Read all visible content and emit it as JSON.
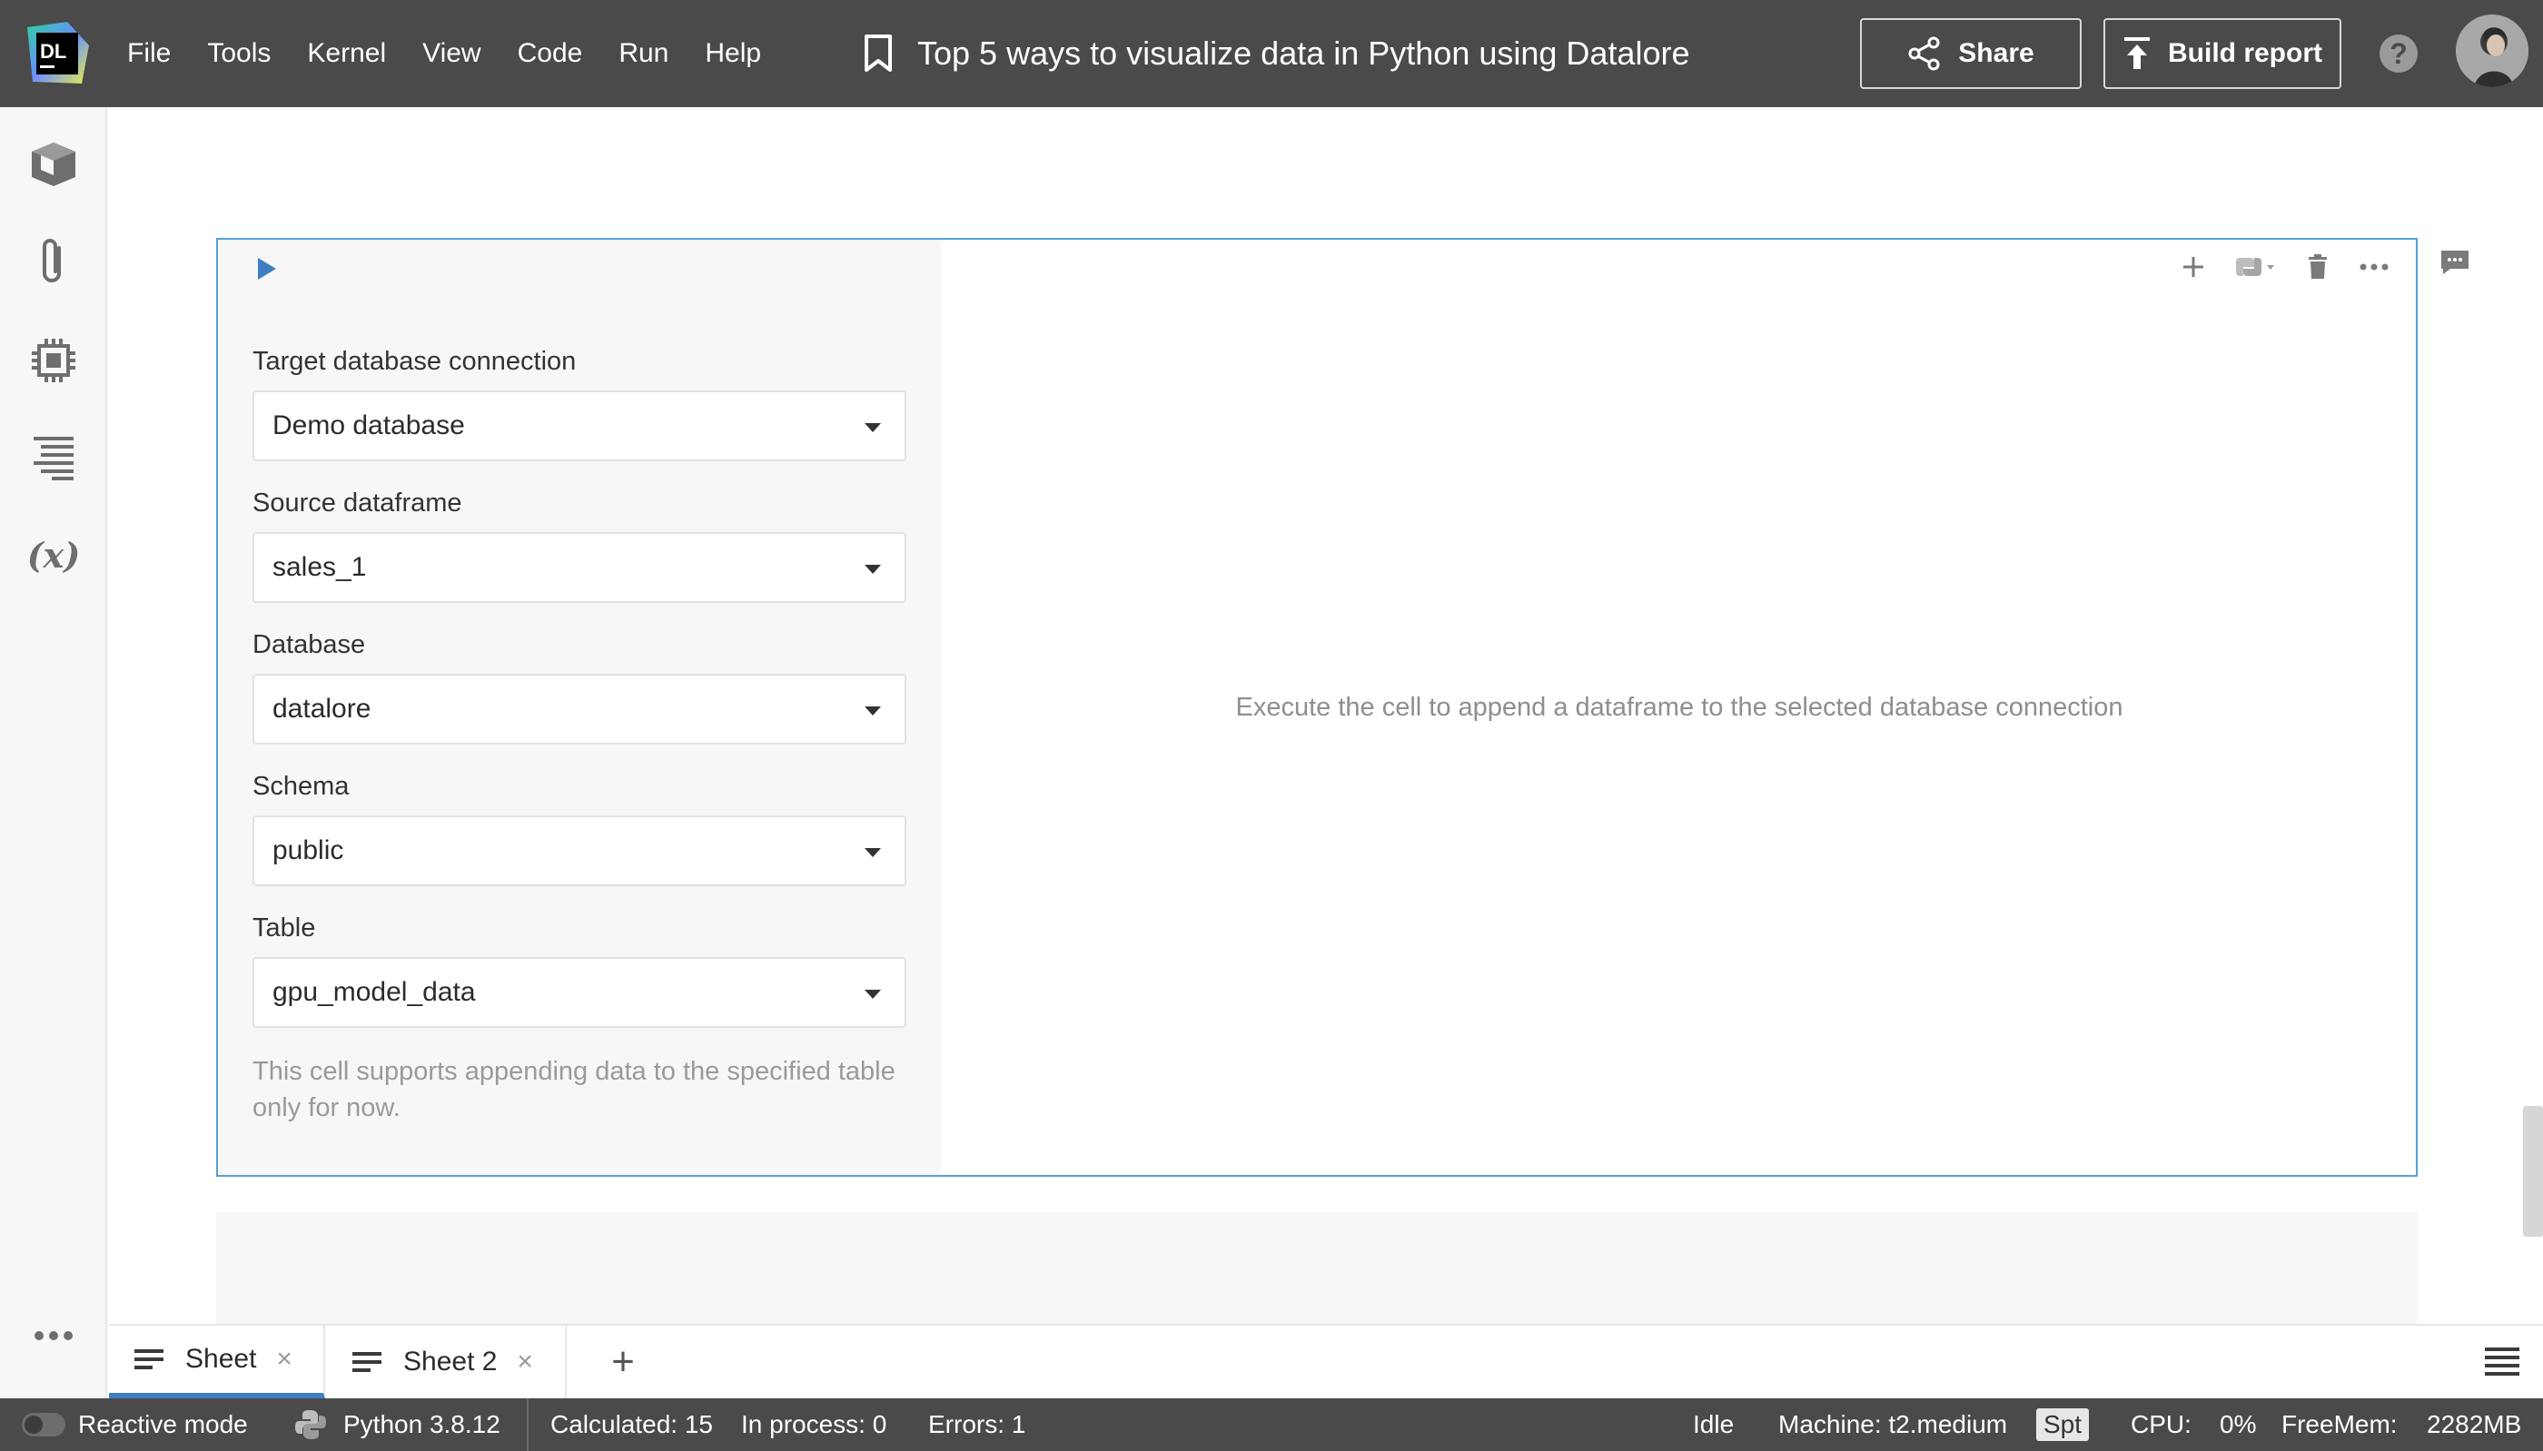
{
  "app": {
    "logo_text": "DL",
    "title": "Top 5 ways to visualize data in Python using Datalore"
  },
  "menu": [
    "File",
    "Tools",
    "Kernel",
    "View",
    "Code",
    "Run",
    "Help"
  ],
  "header_buttons": {
    "share": "Share",
    "build_report": "Build report",
    "help": "?"
  },
  "sidebar_icons": [
    "package-icon",
    "attachment-icon",
    "chip-icon",
    "outline-icon",
    "variables-icon",
    "more-icon"
  ],
  "sidebar": {
    "variables_glyph": "(x)"
  },
  "cell": {
    "fields": [
      {
        "label": "Target database connection",
        "value": "Demo database"
      },
      {
        "label": "Source dataframe",
        "value": "sales_1"
      },
      {
        "label": "Database",
        "value": "datalore"
      },
      {
        "label": "Schema",
        "value": "public"
      },
      {
        "label": "Table",
        "value": "gpu_model_data"
      }
    ],
    "hint": "This cell supports appending data to the specified table only for now.",
    "placeholder": "Execute the cell to append a dataframe to the selected database connection"
  },
  "tabs": [
    {
      "label": "Sheet",
      "active": true
    },
    {
      "label": "Sheet 2",
      "active": false
    }
  ],
  "tab_controls": {
    "close_glyph": "×",
    "add_glyph": "+"
  },
  "status": {
    "reactive_mode": "Reactive mode",
    "python": "Python 3.8.12",
    "calculated": "Calculated: 15",
    "in_process": "In process: 0",
    "errors": "Errors: 1",
    "state": "Idle",
    "machine": "Machine: t2.medium",
    "spot": "Spt",
    "cpu_label": "CPU:",
    "cpu_value": "0%",
    "freemem_label": "FreeMem:",
    "freemem_value": "2282MB"
  },
  "colors": {
    "topbar": "#4a4a4a",
    "accent": "#3d7fc0",
    "cell_border": "#5a9fd4"
  }
}
